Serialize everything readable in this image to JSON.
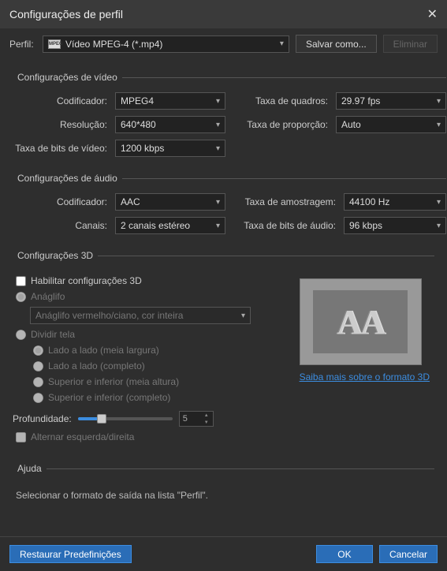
{
  "title": "Configurações de perfil",
  "profile": {
    "label": "Perfil:",
    "value": "Vídeo MPEG-4 (*.mp4)",
    "save_as": "Salvar como...",
    "delete": "Eliminar"
  },
  "video": {
    "legend": "Configurações de vídeo",
    "encoder_label": "Codificador:",
    "encoder": "MPEG4",
    "framerate_label": "Taxa de quadros:",
    "framerate": "29.97 fps",
    "resolution_label": "Resolução:",
    "resolution": "640*480",
    "aspect_label": "Taxa de proporção:",
    "aspect": "Auto",
    "bitrate_label": "Taxa de bits de vídeo:",
    "bitrate": "1200 kbps"
  },
  "audio": {
    "legend": "Configurações de áudio",
    "encoder_label": "Codificador:",
    "encoder": "AAC",
    "samplerate_label": "Taxa de amostragem:",
    "samplerate": "44100 Hz",
    "channels_label": "Canais:",
    "channels": "2 canais estéreo",
    "bitrate_label": "Taxa de bits de áudio:",
    "bitrate": "96 kbps"
  },
  "three_d": {
    "legend": "Configurações 3D",
    "enable": "Habilitar configurações 3D",
    "anaglyph": "Anáglifo",
    "anaglyph_mode": "Anáglifo vermelho/ciano, cor inteira",
    "split": "Dividir tela",
    "sbs_half": "Lado a lado (meia largura)",
    "sbs_full": "Lado a lado (completo)",
    "tab_half": "Superior e inferior (meia altura)",
    "tab_full": "Superior e inferior (completo)",
    "depth_label": "Profundidade:",
    "depth_value": "5",
    "swap": "Alternar esquerda/direita",
    "learn_more": "Saiba mais sobre o formato 3D"
  },
  "help": {
    "legend": "Ajuda",
    "text": "Selecionar o formato de saída na lista \"Perfil\"."
  },
  "footer": {
    "restore": "Restaurar Predefinições",
    "ok": "OK",
    "cancel": "Cancelar"
  }
}
